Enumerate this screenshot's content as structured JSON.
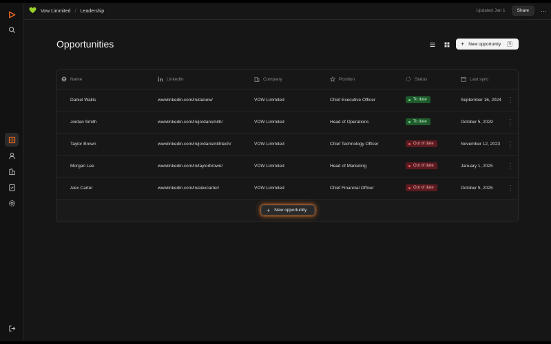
{
  "breadcrumb": {
    "workspace": "Vow Limmited",
    "separator": "/",
    "current": "Leadership"
  },
  "topbar": {
    "updated": "Updated Jan 1",
    "share_label": "Share",
    "more": "···"
  },
  "page": {
    "title": "Opportunities",
    "new_button_label": "New opportunity",
    "new_button_shortcut": "N"
  },
  "table": {
    "columns": [
      "Name",
      "LinkedIn",
      "Company",
      "Position",
      "Status",
      "Last sync"
    ],
    "rows": [
      {
        "name": "Daniel Wallis",
        "linkedin": "wwwlinkedin.com/in/danew/",
        "company": "VOW Limmited",
        "position": "Chief Executive Officer",
        "status": "To date",
        "status_type": "ok",
        "last_sync": "September 16, 2024"
      },
      {
        "name": "Jordan Smith",
        "linkedin": "wwwlinkedin.com/in/jordansmith/",
        "company": "VOW Limmited",
        "position": "Head of Operations",
        "status": "To date",
        "status_type": "ok",
        "last_sync": "October 5, 2029"
      },
      {
        "name": "Taylor Brown",
        "linkedin": "wwwlinkedin.com/in/jordansmithtech/",
        "company": "VOW Limmited",
        "position": "Chief Technology Officer",
        "status": "Out of date",
        "status_type": "bad",
        "last_sync": "November 12, 2023"
      },
      {
        "name": "Morgan Lee",
        "linkedin": "wwwlinkedin.com/in/taylorbrown/",
        "company": "VOW Limmited",
        "position": "Head of Marketing",
        "status": "Out of date",
        "status_type": "bad",
        "last_sync": "January 1, 2025"
      },
      {
        "name": "Alex Carter",
        "linkedin": "wwwlinkedin.com/in/alexcarter/",
        "company": "VOW Limmited",
        "position": "Chief Financial Officer",
        "status": "Out of date",
        "status_type": "bad",
        "last_sync": "October 5, 2025"
      }
    ],
    "add_row_label": "New opportunity"
  },
  "colors": {
    "accent": "#f06a22",
    "logo_heart": "#9ad12b",
    "ok": "#1f5a2c",
    "bad": "#5b1a1f"
  },
  "icons": {
    "rail": [
      "play-logo-icon",
      "search-icon",
      "table-icon",
      "person-icon",
      "building-icon",
      "checklist-icon",
      "settings-icon",
      "logout-icon"
    ]
  }
}
